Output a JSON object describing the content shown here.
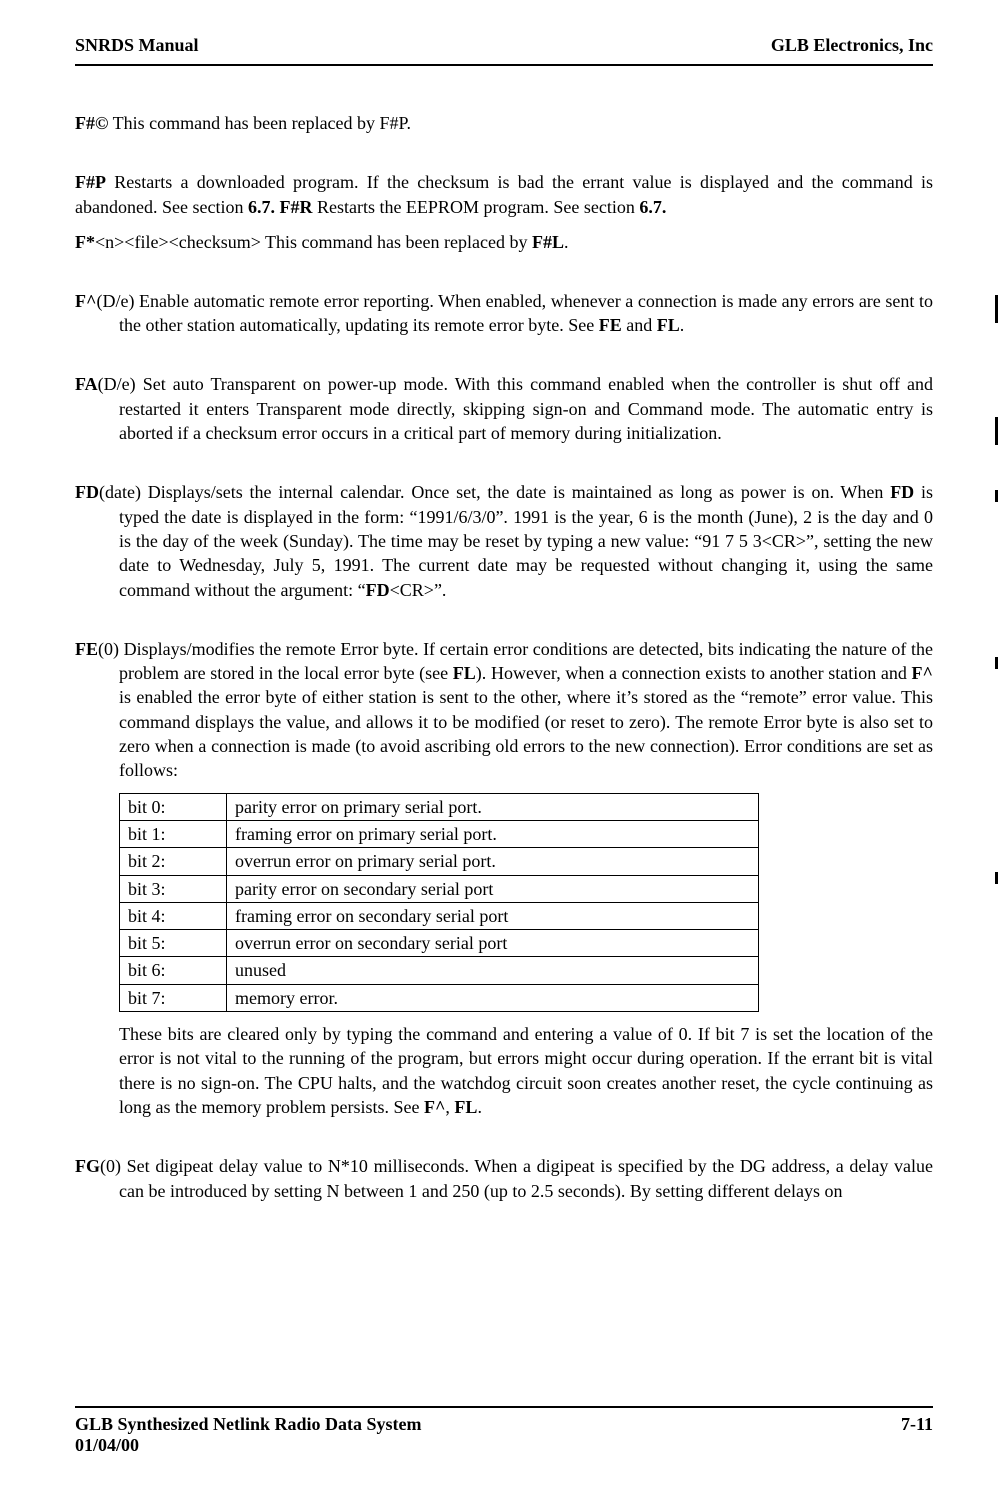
{
  "header": {
    "left": "SNRDS  Manual",
    "right": "GLB Electronics, Inc"
  },
  "entries": {
    "e1": {
      "cmd": "F#©",
      "body": "  This command has been replaced by F#P."
    },
    "e2": {
      "cmd": "F#P",
      "body": "  Restarts a downloaded program. If the checksum is bad the errant value is displayed and the command is abandoned. See section ",
      "bold1": "6.7. F#R",
      "body2": "  Restarts the EEPROM program. See section ",
      "bold2": "6.7."
    },
    "e3": {
      "cmd": "F*",
      "arg": "<n><file><checksum>",
      "body": "  This command has been replaced by ",
      "bold1": "F#L",
      "body2": "."
    },
    "e4": {
      "cmd": "F^",
      "arg": "(D/e)",
      "body": " Enable automatic remote error reporting. When enabled, whenever a connection is made any errors are sent to the other station automatically, updating its remote error byte. See ",
      "bold1": "FE",
      "body2": " and ",
      "bold2": "FL",
      "body3": "."
    },
    "e5": {
      "cmd": "FA",
      "arg": "(D/e)",
      "body": " Set auto Transparent on power-up mode. With this command enabled when the controller is shut off and restarted it enters Transparent mode directly, skipping sign-on and Command mode. The automatic entry is aborted if a checksum error occurs in a critical part of memory during initialization."
    },
    "e6": {
      "cmd": "FD",
      "arg": "(date)",
      "body": " Displays/sets the internal calendar. Once set, the date is maintained as long as power is on. When ",
      "bold1": "FD",
      "body2": " is typed the date is displayed in the form: “1991/6/3/0”. 1991 is the year, 6 is the month (June), 2 is the day and 0 is the day of the week (Sunday). The time may be reset by typing a new value: “91 7 5 3<CR>”, setting the new date to Wednesday, July 5, 1991. The current date may be requested without changing it, using the same command without the argument: “",
      "bold2": "FD",
      "body3": "<CR>”."
    },
    "e7": {
      "cmd": "FE",
      "arg": "(0)",
      "body": " Displays/modifies the remote Error byte. If certain error conditions are detected, bits indicating the nature of the problem are stored in the local error byte (see ",
      "bold1": "FL",
      "body2": "). However, when a connection exists to another station and ",
      "bold2": "F^",
      "body3": " is enabled the error byte of either station is sent to the other, where it’s stored as the “remote” error value. This command displays the value, and allows it to be modified (or reset to zero). The remote Error byte is also set to zero when a connection is made (to avoid ascribing old errors to the new connection). Error conditions are set as follows:",
      "table": [
        {
          "bit": "bit 0:",
          "desc": "parity error on primary serial port."
        },
        {
          "bit": "bit 1:",
          "desc": "framing error on primary serial port."
        },
        {
          "bit": "bit 2:",
          "desc": "overrun error on primary serial port."
        },
        {
          "bit": "bit 3:",
          "desc": "parity error on secondary serial port"
        },
        {
          "bit": "bit 4:",
          "desc": "framing error on secondary serial port"
        },
        {
          "bit": "bit 5:",
          "desc": "overrun error on secondary serial port"
        },
        {
          "bit": "bit 6:",
          "desc": "unused"
        },
        {
          "bit": "bit 7:",
          "desc": "memory error."
        }
      ],
      "after": "These bits are cleared only by typing the command and entering a value of 0. If bit 7 is set the location of the error is not vital to the running of the program, but errors might occur during operation. If the errant bit is vital there is no sign-on. The CPU halts, and the watchdog circuit soon creates another reset, the cycle continuing as long as the memory problem persists. See ",
      "afterbold1": "F^",
      "aftermid": ", ",
      "afterbold2": "FL",
      "aftertail": "."
    },
    "e8": {
      "cmd": "FG",
      "arg": "(0)",
      "body": " Set digipeat delay value to N*10 milliseconds. When a digipeat is specified by the DG address, a delay value can be introduced by setting N between 1 and 250 (up to 2.5 seconds). By setting different delays on"
    }
  },
  "footer": {
    "left_line1": "GLB Synthesized Netlink Radio Data System",
    "left_line2": "01/04/00",
    "right": "7-11"
  }
}
